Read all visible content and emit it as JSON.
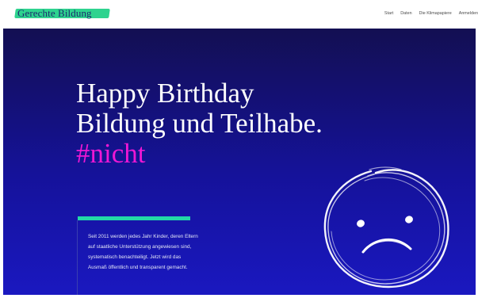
{
  "header": {
    "logo_text": "Gerechte Bildung",
    "nav": [
      "Start",
      "Daten",
      "Die Klimapapiere",
      "Anmelden"
    ]
  },
  "hero": {
    "headline_line1": "Happy Birthday",
    "headline_line2": "Bildung und Teilhabe.",
    "hashtag": "#nicht",
    "intro_lines": [
      "Seit 2011 werden jedes Jahr Kinder, deren Eltern",
      "auf staatliche Unterstützung angewiesen sind,",
      "systematisch benachteiligt. Jetzt wird das",
      "Ausmaß öffentlich und transparent gemacht."
    ],
    "illustration_icon": "sad-face-icon"
  },
  "colors": {
    "logo_highlight": "#2ed38f",
    "hashtag": "#ee17d4",
    "accent_bar": "#22d8a7",
    "hero_background": "#15129a"
  }
}
